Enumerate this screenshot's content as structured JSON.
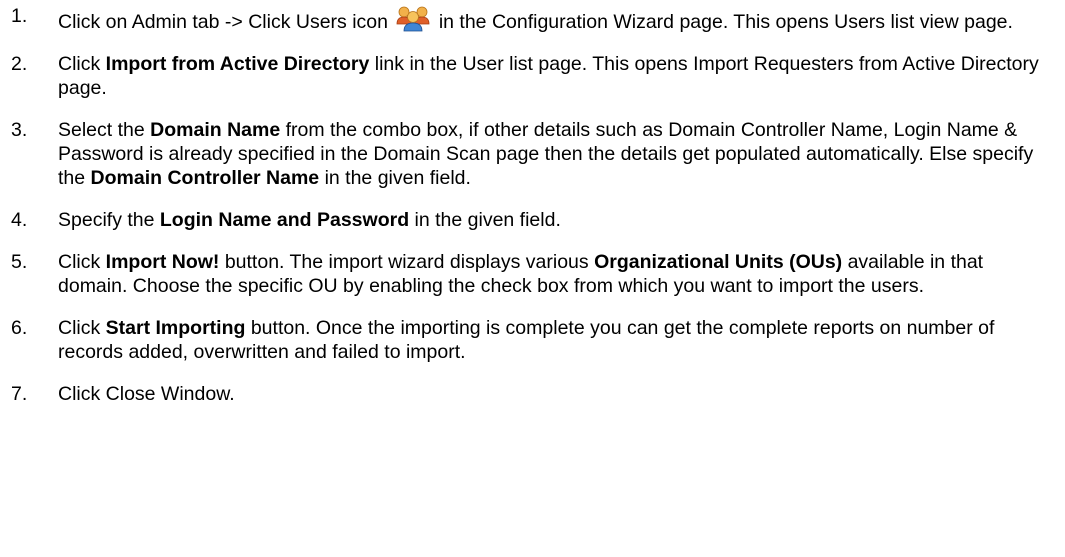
{
  "steps": [
    {
      "num": "1.",
      "t1": "Click on Admin tab -> Click Users icon ",
      "icon": "users-icon",
      "t2": " in the Configuration Wizard page. This opens Users list view page."
    },
    {
      "num": "2.",
      "t1": "Click ",
      "b1": "Import from Active Directory",
      "t2": " link in the User list page. This opens Import Requesters from Active Directory page."
    },
    {
      "num": "3.",
      "t1": "Select the ",
      "b1": "Domain Name",
      "t2": " from the combo box, if other details such as Domain Controller Name, Login Name & Password is already specified in the Domain Scan page then the details get populated automatically. Else specify the ",
      "b2": "Domain Controller Name",
      "t3": " in the given field."
    },
    {
      "num": "4.",
      "t1": "Specify the ",
      "b1": "Login Name and Password",
      "t2": " in the given field."
    },
    {
      "num": "5.",
      "t1": "Click ",
      "b1": "Import Now!",
      "t2": " button. The import wizard displays various ",
      "b2": "Organizational Units (OUs)",
      "t3": " available in that domain. Choose the specific OU by enabling the check box from which you want to import the users."
    },
    {
      "num": "6.",
      "t1": "Click ",
      "b1": "Start Importing",
      "t2": " button. Once the importing is complete you can get the complete reports on number of records added, overwritten and failed to import."
    },
    {
      "num": "7.",
      "t1": "Click Close Window."
    }
  ]
}
